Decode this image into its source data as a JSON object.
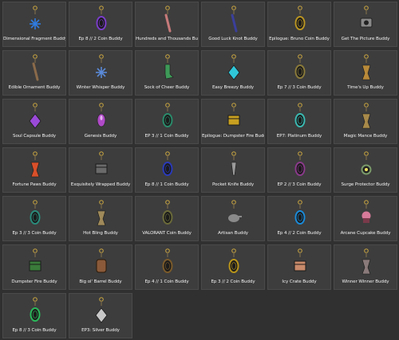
{
  "gallery": {
    "items": [
      {
        "label": "Dimensional Fragment Buddy",
        "icon": "crystal-shard-icon",
        "color": "#2f7be0"
      },
      {
        "label": "Ep 8 // 2 Coin Buddy",
        "icon": "coin-icon",
        "color": "#7a3cc9"
      },
      {
        "label": "Hundreds and Thousands Buddy",
        "icon": "sprinkle-stick-icon",
        "color": "#c77a7a"
      },
      {
        "label": "Good Luck Knot Buddy",
        "icon": "knot-icon",
        "color": "#3a3f9a"
      },
      {
        "label": "Epilogue: Bruno Coin Buddy",
        "icon": "coin-icon",
        "color": "#b89422"
      },
      {
        "label": "Get The Picture Buddy",
        "icon": "camera-icon",
        "color": "#8a8a8a"
      },
      {
        "label": "Edible Ornament Buddy",
        "icon": "ornament-stick-icon",
        "color": "#8a6a4a"
      },
      {
        "label": "Winter Whisper Buddy",
        "icon": "snowflake-icon",
        "color": "#5a8ad8"
      },
      {
        "label": "Sock of Cheer Buddy",
        "icon": "sock-icon",
        "color": "#3e9a58"
      },
      {
        "label": "Easy Breezy Buddy",
        "icon": "gem-icon",
        "color": "#2fc6d8"
      },
      {
        "label": "Ep 7 // 3 Coin Buddy",
        "icon": "coin-icon",
        "color": "#8a7a3a"
      },
      {
        "label": "Time's Up Buddy",
        "icon": "hourglass-icon",
        "color": "#b88a3a"
      },
      {
        "label": "Soul Capsule Buddy",
        "icon": "capsule-icon",
        "color": "#9a4ad8"
      },
      {
        "label": "Genesis Buddy",
        "icon": "genesis-capsule-icon",
        "color": "#b04ac8"
      },
      {
        "label": "EP 3 // 1 Coin Buddy",
        "icon": "coin-icon",
        "color": "#2a8a6a"
      },
      {
        "label": "Epilogue: Dumpster Fire Buddy",
        "icon": "dumpster-icon",
        "color": "#c8a020"
      },
      {
        "label": "EP7: Platinum Buddy",
        "icon": "platinum-coin-icon",
        "color": "#3ab8b0"
      },
      {
        "label": "Magic Mance Buddy",
        "icon": "mance-figure-icon",
        "color": "#a88a4a"
      },
      {
        "label": "Fortune Paws Buddy",
        "icon": "paw-charm-icon",
        "color": "#d8502a"
      },
      {
        "label": "Exquisitely Wrapped Buddy",
        "icon": "gift-box-icon",
        "color": "#6a6a6a"
      },
      {
        "label": "Ep 8 // 1 Coin Buddy",
        "icon": "coin-icon",
        "color": "#2a3ab8"
      },
      {
        "label": "Pocket Knife Buddy",
        "icon": "knife-icon",
        "color": "#9a9a9a"
      },
      {
        "label": "EP 2 // 3 Coin Buddy",
        "icon": "coin-icon",
        "color": "#8a3a8a"
      },
      {
        "label": "Surge Protector Buddy",
        "icon": "surge-icon",
        "color": "#7a9a6a"
      },
      {
        "label": "Ep 3 // 3 Coin Buddy",
        "icon": "coin-icon",
        "color": "#2a8a7a"
      },
      {
        "label": "Hot Bling Buddy",
        "icon": "bling-icon",
        "color": "#a08a5a"
      },
      {
        "label": "VALORANT Coin Buddy",
        "icon": "coin-icon",
        "color": "#6a6a3a"
      },
      {
        "label": "Artisan Buddy",
        "icon": "teapot-icon",
        "color": "#8a8a8a"
      },
      {
        "label": "Ep 4 // 2 Coin Buddy",
        "icon": "coin-icon",
        "color": "#1a8ad8"
      },
      {
        "label": "Arcane Cupcake Buddy",
        "icon": "cupcake-icon",
        "color": "#d87a9a"
      },
      {
        "label": "Dumpster Fire Buddy",
        "icon": "dumpster-icon",
        "color": "#3a7a3a"
      },
      {
        "label": "Big ol' Barrel Buddy",
        "icon": "barrel-icon",
        "color": "#8a5a3a"
      },
      {
        "label": "Ep 4 // 1 Coin Buddy",
        "icon": "coin-icon",
        "color": "#7a5a2a"
      },
      {
        "label": "Ep 3 // 2 Coin Buddy",
        "icon": "coin-icon",
        "color": "#b8941a"
      },
      {
        "label": "Icy Crate Buddy",
        "icon": "crate-icon",
        "color": "#c88a6a"
      },
      {
        "label": "Winner Winner Buddy",
        "icon": "trophy-icon",
        "color": "#8a7a7a"
      },
      {
        "label": "Ep 8 // 3 Coin Buddy",
        "icon": "coin-icon",
        "color": "#2ab85a"
      },
      {
        "label": "EP3: Silver Buddy",
        "icon": "silver-diamond-icon",
        "color": "#c8c8c8"
      }
    ]
  }
}
